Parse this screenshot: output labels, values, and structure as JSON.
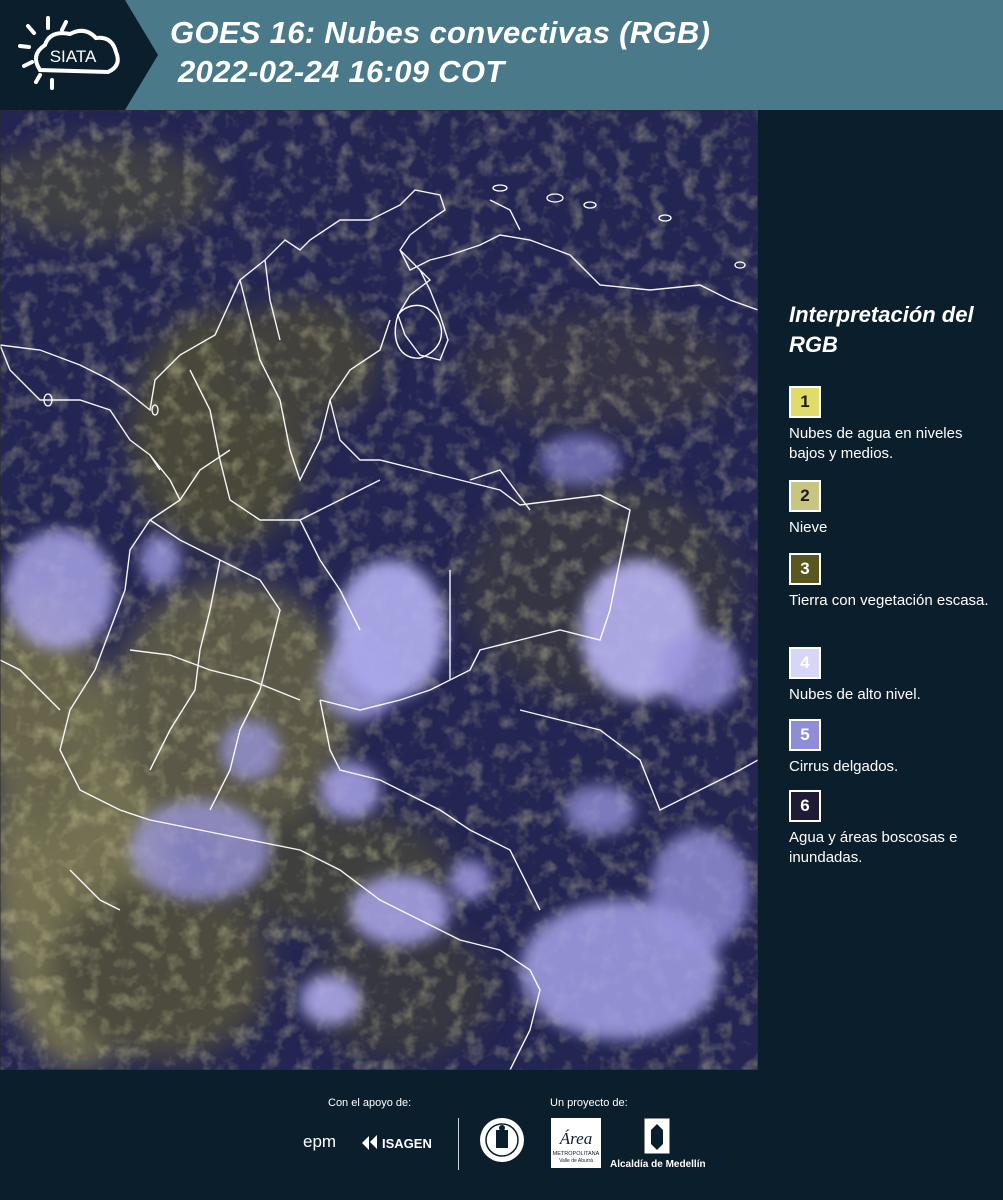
{
  "header": {
    "logo_text": "SIATA",
    "title_line1": "GOES 16: Nubes convectivas (RGB)",
    "title_line2": "2022-02-24 16:09 COT"
  },
  "map": {
    "layer": "GOES 16 convective clouds RGB composite",
    "colors": {
      "background": "#222451",
      "low_clouds": "#c9c46a",
      "high_clouds": "#b7b4f0",
      "borders": "#ffffff"
    }
  },
  "legend": {
    "title": "Interpretación del RGB",
    "items": [
      {
        "number": "1",
        "label": "Nubes de agua en niveles bajos y medios.",
        "color": "#e0dc6a"
      },
      {
        "number": "2",
        "label": "Nieve",
        "color": "#c8c481"
      },
      {
        "number": "3",
        "label": "Tierra con vegetación escasa.",
        "color": "#595620"
      },
      {
        "number": "4",
        "label": "Nubes de alto nivel.",
        "color": "#d7d6f7"
      },
      {
        "number": "5",
        "label": "Cirrus delgados.",
        "color": "#8f8dd6"
      },
      {
        "number": "6",
        "label": "Agua y áreas boscosas e inundadas.",
        "color": "#1f1b35"
      }
    ]
  },
  "footer": {
    "support_label": "Con el apoyo de:",
    "project_label": "Un proyecto de:",
    "sponsors": [
      "epm",
      "ISAGEN"
    ],
    "partners": {
      "area_logo_text": "Área",
      "area_sub": "METROPOLITANA",
      "area_sub2": "Valle de Aburrá",
      "alcaldia": "Alcaldía de Medellín"
    }
  }
}
